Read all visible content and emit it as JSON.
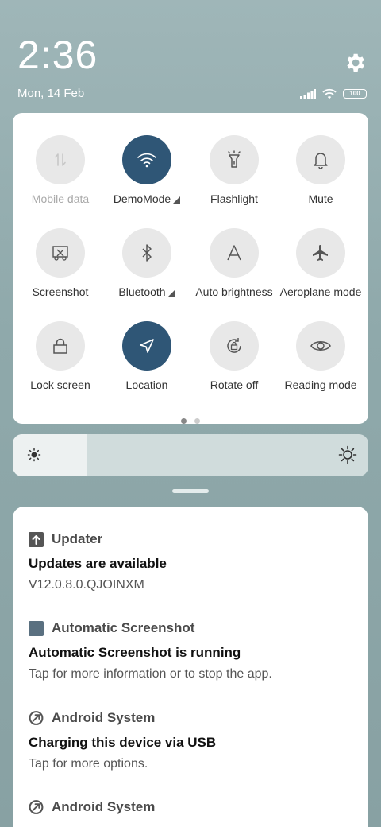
{
  "status": {
    "time": "2:36",
    "date": "Mon, 14 Feb",
    "battery": "100"
  },
  "quick_settings": {
    "tiles": [
      {
        "label": "Mobile data",
        "icon": "mobile-data-icon",
        "active": false,
        "disabled": true
      },
      {
        "label": "DemoMode",
        "icon": "wifi-icon",
        "active": true,
        "expandable": true
      },
      {
        "label": "Flashlight",
        "icon": "flashlight-icon",
        "active": false
      },
      {
        "label": "Mute",
        "icon": "bell-icon",
        "active": false
      },
      {
        "label": "Screenshot",
        "icon": "screenshot-icon",
        "active": false
      },
      {
        "label": "Bluetooth",
        "icon": "bluetooth-icon",
        "active": false,
        "expandable": true
      },
      {
        "label": "Auto brightness",
        "icon": "auto-brightness-icon",
        "active": false
      },
      {
        "label": "Aeroplane mode",
        "icon": "airplane-icon",
        "active": false
      },
      {
        "label": "Lock screen",
        "icon": "lock-icon",
        "active": false
      },
      {
        "label": "Location",
        "icon": "location-icon",
        "active": true
      },
      {
        "label": "Rotate off",
        "icon": "rotate-lock-icon",
        "active": false
      },
      {
        "label": "Reading mode",
        "icon": "eye-icon",
        "active": false
      }
    ],
    "page_count": 2,
    "current_page": 1
  },
  "brightness": {
    "level": 0.21
  },
  "notifications": [
    {
      "app": "Updater",
      "icon": "upload-arrow-icon",
      "title": "Updates are available",
      "text": "V12.0.8.0.QJOINXM"
    },
    {
      "app": "Automatic Screenshot",
      "icon": "app-square-icon",
      "title": "Automatic Screenshot is running",
      "text": "Tap for more information or to stop the app."
    },
    {
      "app": "Android System",
      "icon": "android-system-icon",
      "title": "Charging this device via USB",
      "text": "Tap for more options."
    },
    {
      "app": "Android System",
      "icon": "android-system-icon",
      "title": "",
      "text": ""
    }
  ],
  "colors": {
    "active_tile": "#2f5676",
    "inactive_tile": "#e8e8e8",
    "background": "#9fb6b8"
  }
}
